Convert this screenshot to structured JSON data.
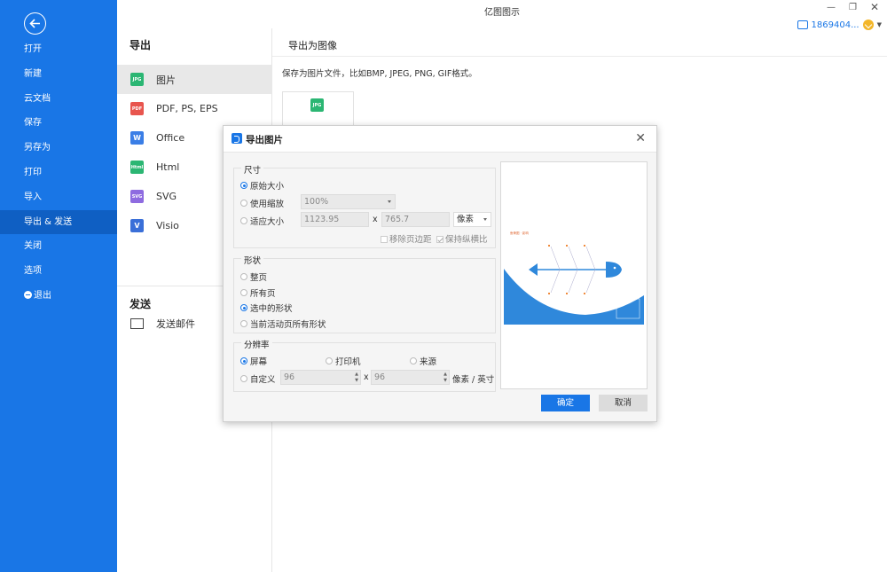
{
  "app_title": "亿图图示",
  "sidebar": {
    "items": [
      {
        "label": "打开"
      },
      {
        "label": "新建"
      },
      {
        "label": "云文档"
      },
      {
        "label": "保存"
      },
      {
        "label": "另存为"
      },
      {
        "label": "打印"
      },
      {
        "label": "导入"
      },
      {
        "label": "导出 & 发送"
      },
      {
        "label": "关闭"
      },
      {
        "label": "选项"
      },
      {
        "label": "退出"
      }
    ]
  },
  "account": {
    "name": "1869404..."
  },
  "export": {
    "title": "导出",
    "items": [
      {
        "label": "图片",
        "icon": "JPG",
        "color": "#2bb673"
      },
      {
        "label": "PDF, PS, EPS",
        "icon": "PDF",
        "color": "#e8554e"
      },
      {
        "label": "Office",
        "icon": "W",
        "color": "#3a7ee6"
      },
      {
        "label": "Html",
        "icon": "Html",
        "color": "#2bb673"
      },
      {
        "label": "SVG",
        "icon": "SVG",
        "color": "#8e6be0"
      },
      {
        "label": "Visio",
        "icon": "V",
        "color": "#3a6fd8"
      }
    ],
    "send_title": "发送",
    "send_mail": "发送邮件"
  },
  "right": {
    "title": "导出为图像",
    "desc": "保存为图片文件，比如BMP, JPEG, PNG, GIF格式。",
    "card_icon": "JPG"
  },
  "dialog": {
    "title": "导出图片",
    "size": {
      "label": "尺寸",
      "original": "原始大小",
      "use_zoom": "使用缩放",
      "zoom_value": "100%",
      "fit": "适应大小",
      "width": "1123.95",
      "x": "x",
      "height": "765.7",
      "unit": "像素",
      "remove_margin": "移除页边距",
      "keep_ratio": "保持纵横比"
    },
    "shape": {
      "label": "形状",
      "options": [
        "整页",
        "所有页",
        "选中的形状",
        "当前活动页所有形状"
      ],
      "selected": 2
    },
    "resolution": {
      "label": "分辨率",
      "screen": "屏幕",
      "printer": "打印机",
      "source": "来源",
      "custom": "自定义",
      "dpi_x": "96",
      "x": "x",
      "dpi_y": "96",
      "unit": "像素 / 英寸"
    },
    "ok": "确定",
    "cancel": "取消",
    "preview_title": "鱼骨图 · 影响"
  }
}
